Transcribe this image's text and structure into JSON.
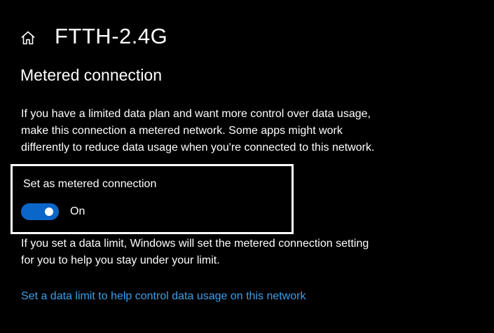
{
  "header": {
    "icon": "home-icon",
    "title": "FTTH-2.4G"
  },
  "section": {
    "title": "Metered connection",
    "description_lines": [
      "If you have a limited data plan and want more control over data usage,",
      "make this connection a metered network. Some apps might work",
      "differently to reduce data usage when you're connected to this network."
    ]
  },
  "metered_toggle": {
    "label": "Set as metered connection",
    "state_text": "On",
    "is_on": true
  },
  "limit_note": {
    "lines": [
      "If you set a data limit, Windows will set the metered connection setting",
      "for you to help you stay under your limit."
    ]
  },
  "link": {
    "text": "Set a data limit to help control data usage on this network"
  },
  "colors": {
    "background": "#000000",
    "text": "#ffffff",
    "accent": "#0a66c8",
    "link": "#3b9fe8",
    "highlight_border": "#ffffff"
  }
}
